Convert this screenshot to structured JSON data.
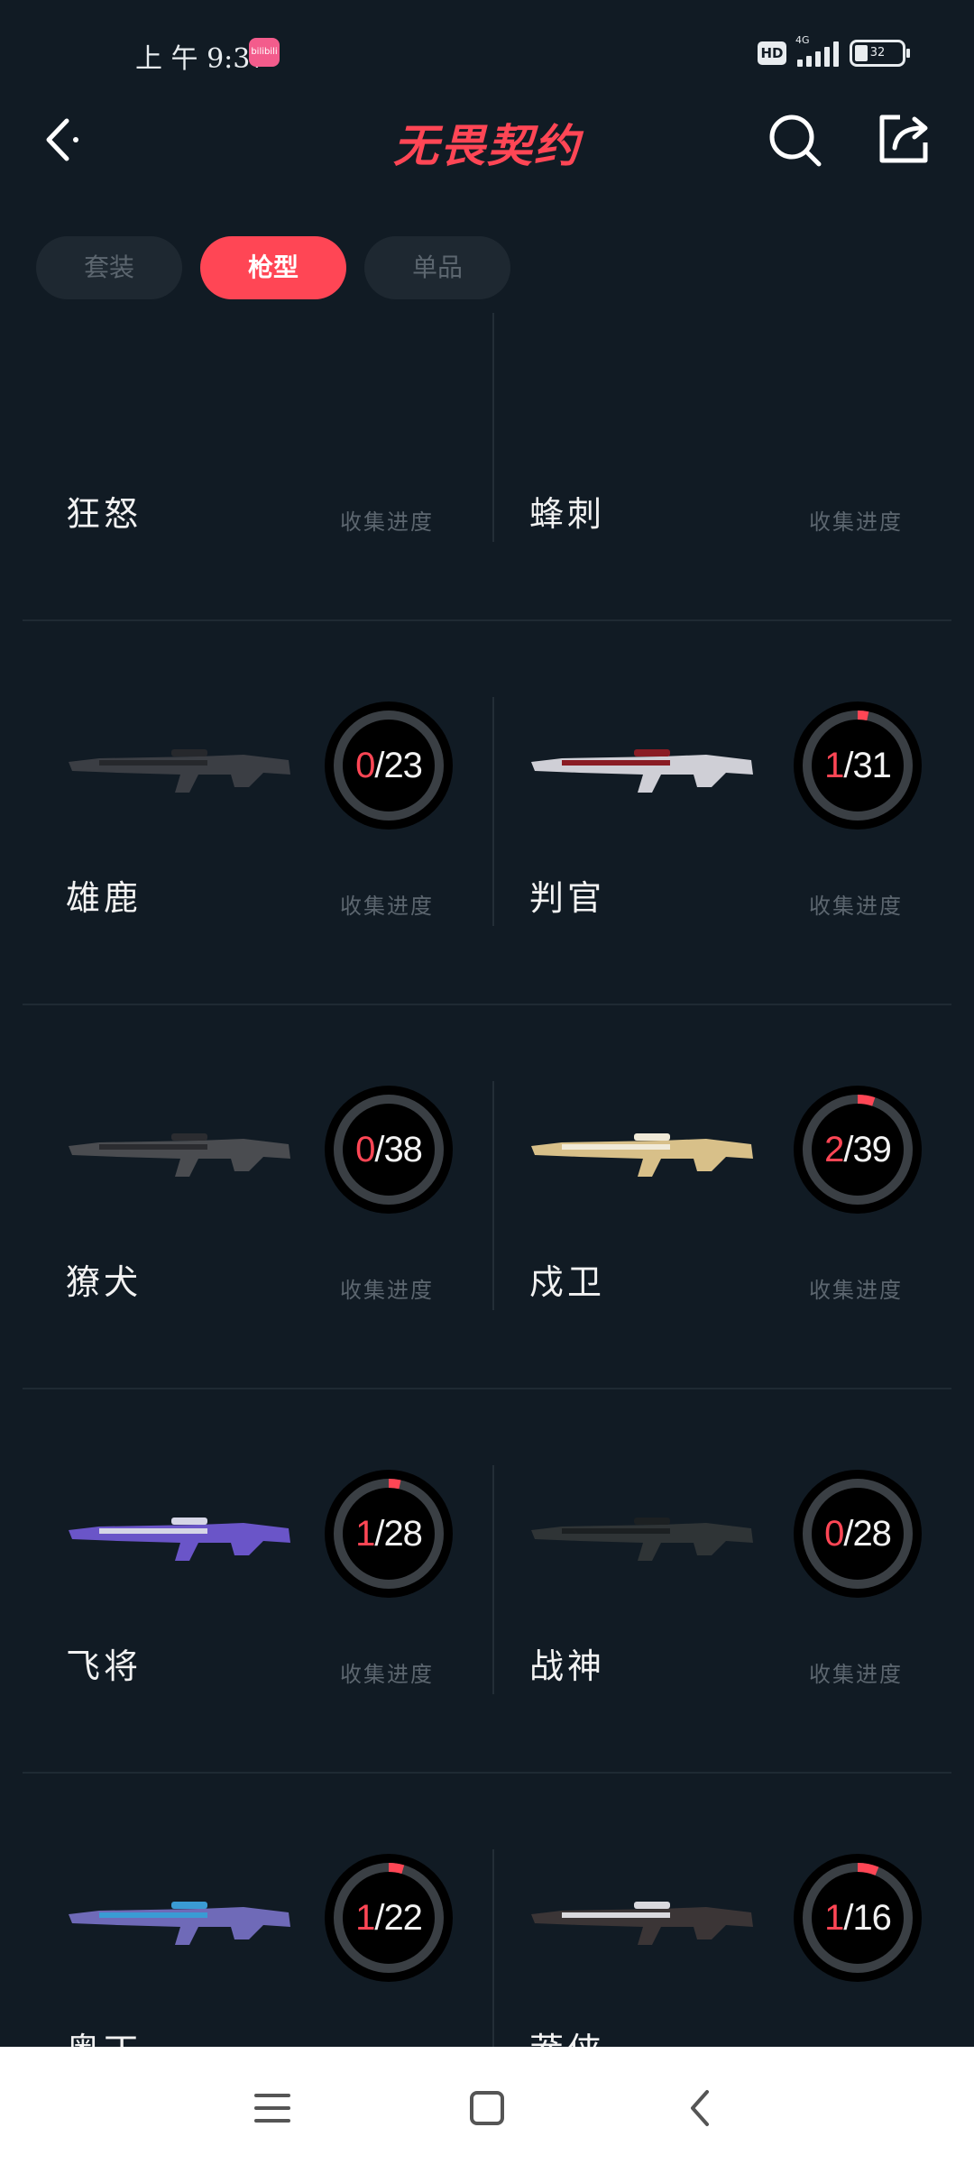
{
  "status_bar": {
    "time": "上 午 9:37",
    "app_icon_text": "bilibili",
    "hd": "HD",
    "network": "4G",
    "battery": "32"
  },
  "header": {
    "title": "无畏契约",
    "back_icon": "chevron-left-icon",
    "search_icon": "search-icon",
    "share_icon": "share-icon"
  },
  "tabs": [
    {
      "label": "套装",
      "active": false
    },
    {
      "label": "枪型",
      "active": true
    },
    {
      "label": "单品",
      "active": false
    }
  ],
  "progress_label": "收集进度",
  "weapons": [
    {
      "name": "狂怒",
      "collected": "",
      "total": ""
    },
    {
      "name": "蜂刺",
      "collected": "",
      "total": ""
    },
    {
      "name": "雄鹿",
      "collected": "0",
      "total": "23"
    },
    {
      "name": "判官",
      "collected": "1",
      "total": "31"
    },
    {
      "name": "獠犬",
      "collected": "0",
      "total": "38"
    },
    {
      "name": "戍卫",
      "collected": "2",
      "total": "39"
    },
    {
      "name": "飞将",
      "collected": "1",
      "total": "28"
    },
    {
      "name": "战神",
      "collected": "0",
      "total": "28"
    },
    {
      "name": "奥丁",
      "collected": "1",
      "total": "22"
    },
    {
      "name": "莽侠",
      "collected": "1",
      "total": "16"
    }
  ],
  "nav_bar": {
    "menu_icon": "menu-icon",
    "home_icon": "home-square-icon",
    "back_icon": "back-triangle-icon"
  },
  "colors": {
    "accent": "#ff4655",
    "background": "#111b24",
    "tab_inactive": "#1e2831",
    "ring_track": "#3a3f44"
  }
}
